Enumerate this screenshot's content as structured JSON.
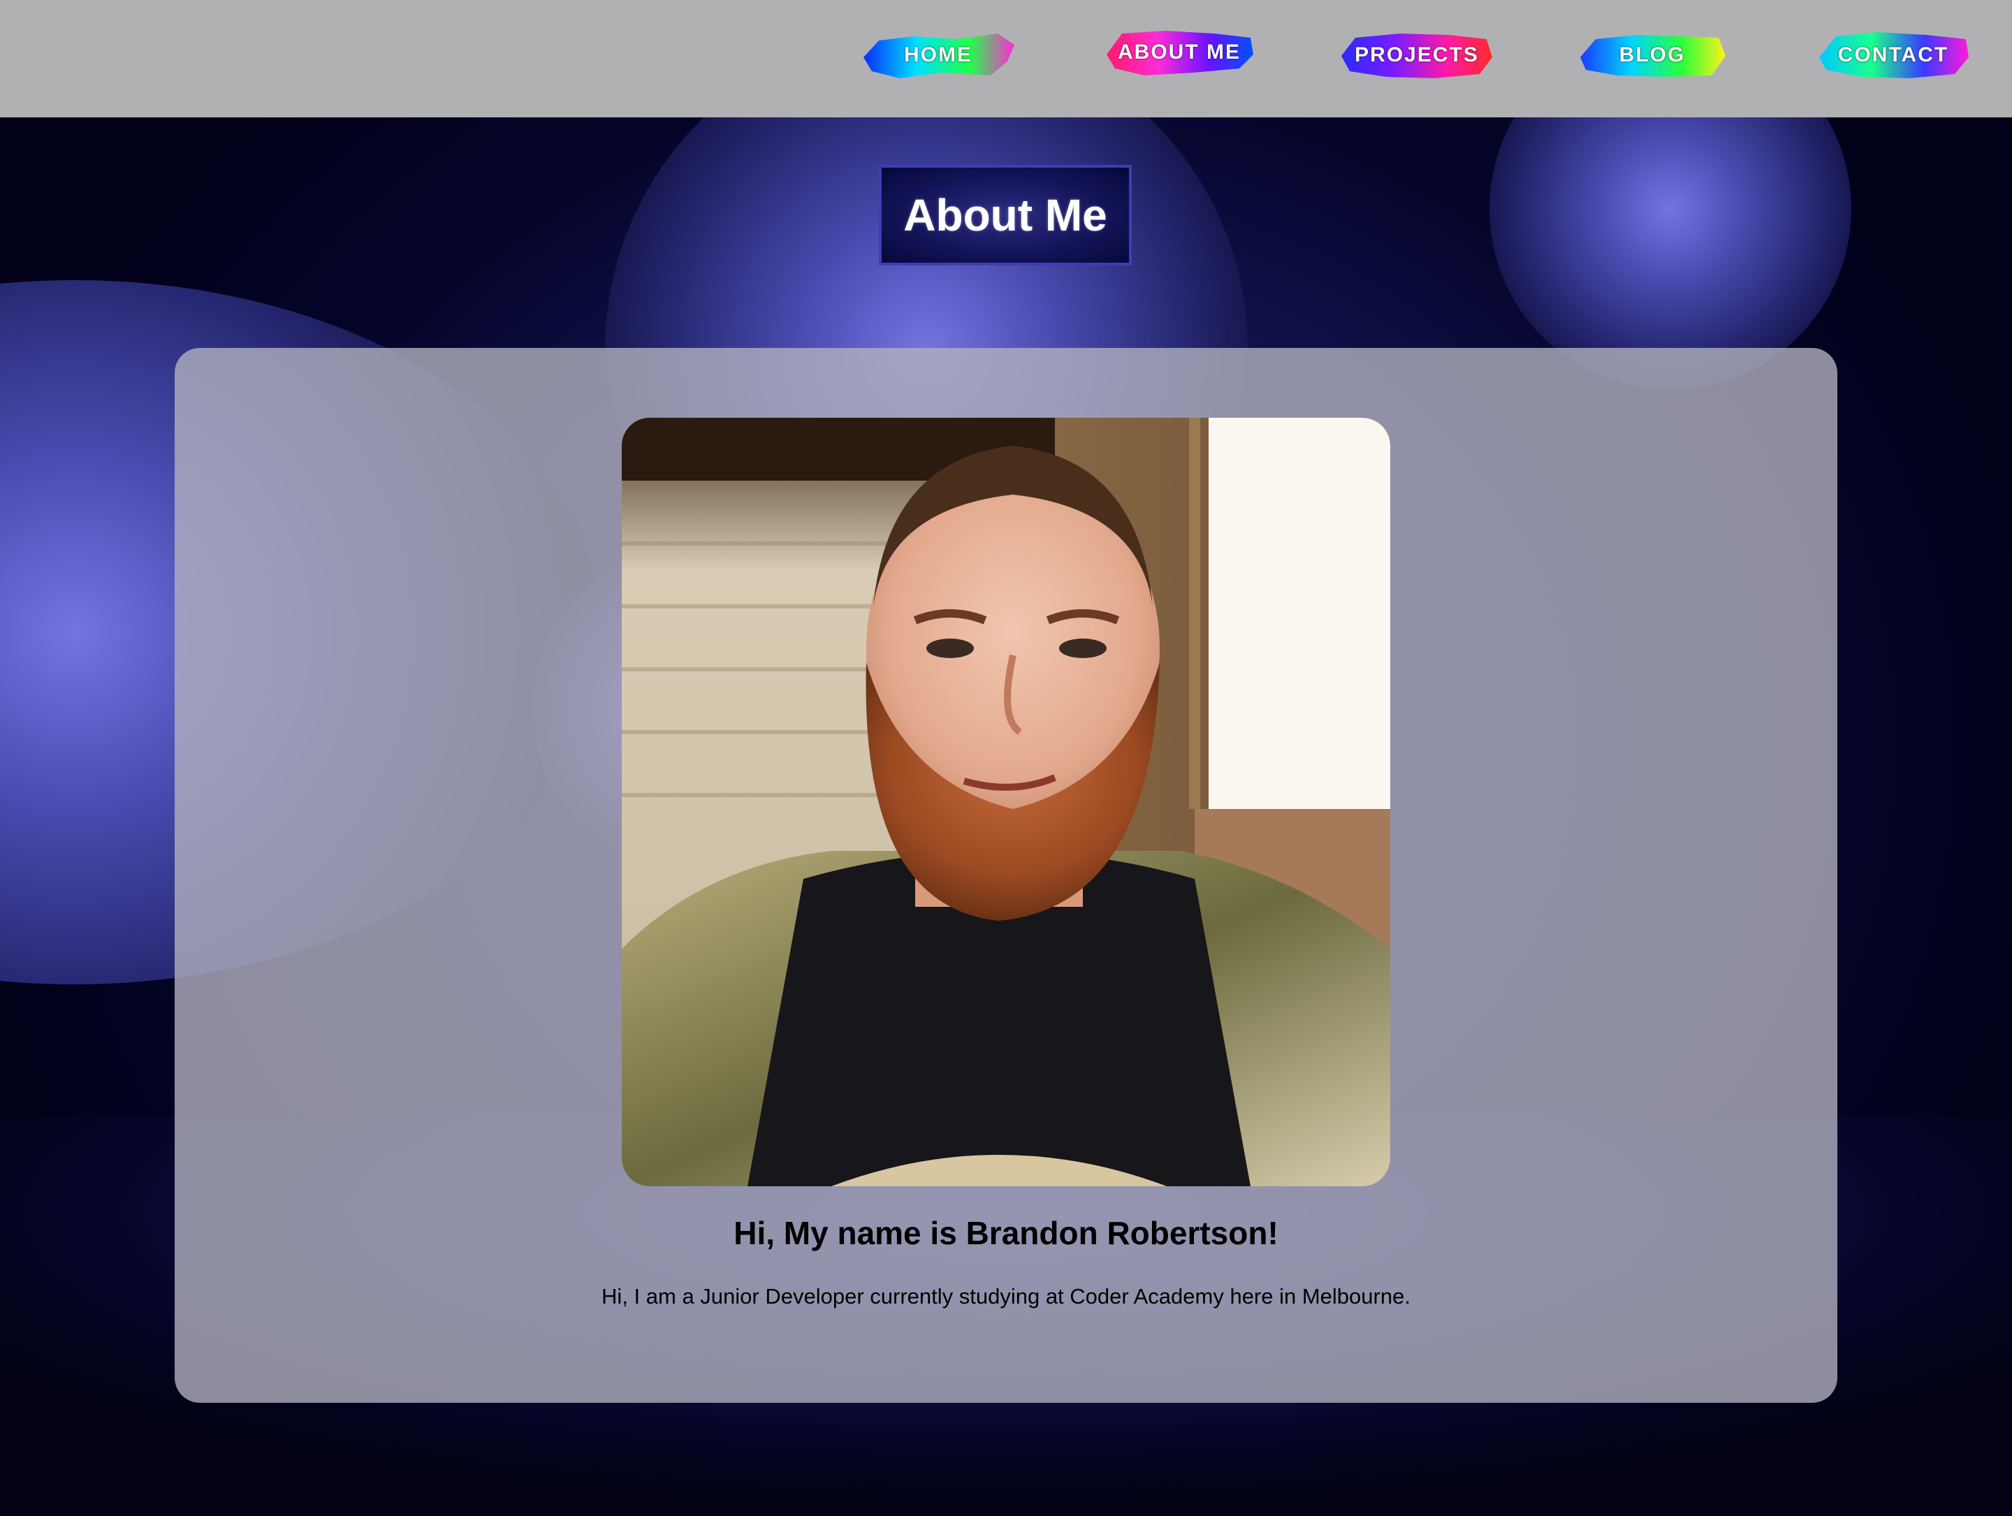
{
  "nav": {
    "items": [
      {
        "label": "HOME",
        "splash": [
          "#0a2cff",
          "#00e0ff",
          "#21ff4a",
          "#ff2ad4"
        ]
      },
      {
        "label": "ABOUT ME",
        "splash": [
          "#ff1b6b",
          "#ff2cd8",
          "#6a12ff",
          "#0050ff"
        ]
      },
      {
        "label": "PROJECTS",
        "splash": [
          "#2b2bff",
          "#7a1cff",
          "#ff1aa6",
          "#ff2a2a"
        ]
      },
      {
        "label": "BLOG",
        "splash": [
          "#1a3cff",
          "#00d4ff",
          "#2aff3a",
          "#fff21a"
        ]
      },
      {
        "label": "CONTACT",
        "splash": [
          "#00c8ff",
          "#1aff8c",
          "#3a3aff",
          "#ff1ad9"
        ]
      }
    ]
  },
  "page": {
    "title": "About Me"
  },
  "about": {
    "photo_alt": "portrait-photo",
    "heading": "Hi, My name is Brandon Robertson!",
    "bio": "Hi, I am a Junior Developer currently studying at Coder Academy here in Melbourne."
  },
  "colors": {
    "navbar_bg": "#b1b1b3",
    "title_border": "#3a3fb5",
    "scene_accent": "#7374e0"
  }
}
